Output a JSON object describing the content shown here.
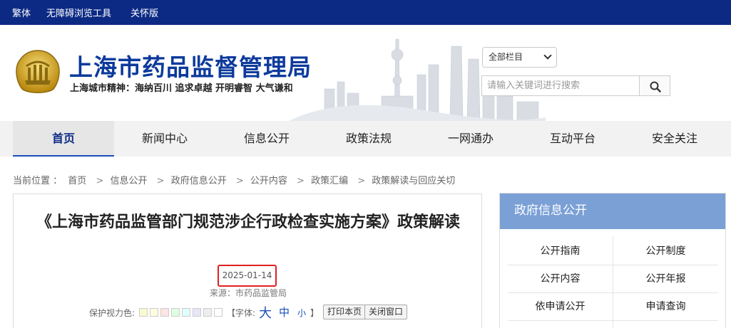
{
  "topbar": {
    "traditional": "繁体",
    "accessibility": "无障碍浏览工具",
    "care_mode": "关怀版"
  },
  "header": {
    "title": "上海市药品监督管理局",
    "slogan": "上海城市精神：海纳百川  追求卓越  开明睿智  大气谦和",
    "colors": {
      "title": "#0c3a9c",
      "topbar": "#0c2a84"
    }
  },
  "search": {
    "scope_selected": "全部栏目",
    "placeholder": "请输入关键词进行搜索",
    "icon": "search-icon"
  },
  "nav": {
    "items": [
      {
        "label": "首页",
        "active": true
      },
      {
        "label": "新闻中心",
        "active": false
      },
      {
        "label": "信息公开",
        "active": false
      },
      {
        "label": "政策法规",
        "active": false
      },
      {
        "label": "一网通办",
        "active": false
      },
      {
        "label": "互动平台",
        "active": false
      },
      {
        "label": "安全关注",
        "active": false
      }
    ]
  },
  "breadcrumb": {
    "prefix": "当前位置 ：",
    "items": [
      "首页",
      "信息公开",
      "政府信息公开",
      "公开内容",
      "政策汇编",
      "政策解读与回应关切"
    ],
    "separator": ">"
  },
  "article": {
    "title": "《上海市药品监管部门规范涉企行政检查实施方案》政策解读",
    "date": "2025-01-14",
    "source": "来源：市药品监管局",
    "eye_care_label": "保护视力色:",
    "eye_care_colors": [
      "#fafad2",
      "#ffffe0",
      "#ffe4e1",
      "#e0ffe0",
      "#e0ffff",
      "#e6e6fa",
      "#eeeeee",
      "#ffffff"
    ],
    "font_label": "【字体:",
    "font_large": "大",
    "font_medium": "中",
    "font_small": "小",
    "font_close": "】",
    "print_label": "打印本页",
    "close_label": "关闭窗口"
  },
  "sidebar": {
    "title": "政府信息公开",
    "links": [
      "公开指南",
      "公开制度",
      "公开内容",
      "公开年报",
      "依申请公开",
      "申请查询"
    ]
  }
}
